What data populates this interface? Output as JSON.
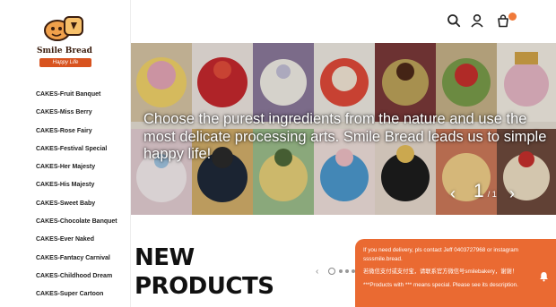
{
  "brand": {
    "name": "Smile Bread",
    "tagline": "Happy Life"
  },
  "sidebar": {
    "items": [
      {
        "label": "CAKES-Fruit Banquet"
      },
      {
        "label": "CAKES-Miss Berry"
      },
      {
        "label": "CAKES-Rose Fairy"
      },
      {
        "label": "CAKES-Festival Special"
      },
      {
        "label": "CAKES-Her Majesty"
      },
      {
        "label": "CAKES-His Majesty"
      },
      {
        "label": "CAKES-Sweet Baby"
      },
      {
        "label": "CAKES-Chocolate Banquet"
      },
      {
        "label": "CAKES-Ever Naked"
      },
      {
        "label": "CAKES-Fantacy Carnival"
      },
      {
        "label": "CAKES-Childhood Dream"
      },
      {
        "label": "CAKES-Super Cartoon"
      }
    ]
  },
  "header": {
    "icons": [
      "search-icon",
      "user-icon",
      "cart-icon"
    ]
  },
  "banner": {
    "text": "Choose the purest ingredients from the nature and use the most delicate processing arts. Smile Bread leads us to simple happy life!",
    "current_slide": "1",
    "separator": "/ 1"
  },
  "new_products": {
    "title_line1": "NEW",
    "title_line2": "PRODUCTS"
  },
  "notice": {
    "line1": "If you need delivery, pls contact Jeff 0403727968 or instagram ssssmile.bread.",
    "line2": "若微信支付或支付宝，请联系官方微信号smilebakery，谢谢！",
    "line3": "***Products with *** means special. Please see its description."
  },
  "colors": {
    "accent": "#ea6a32",
    "badge": "#f07a3a",
    "text": "#222222"
  }
}
